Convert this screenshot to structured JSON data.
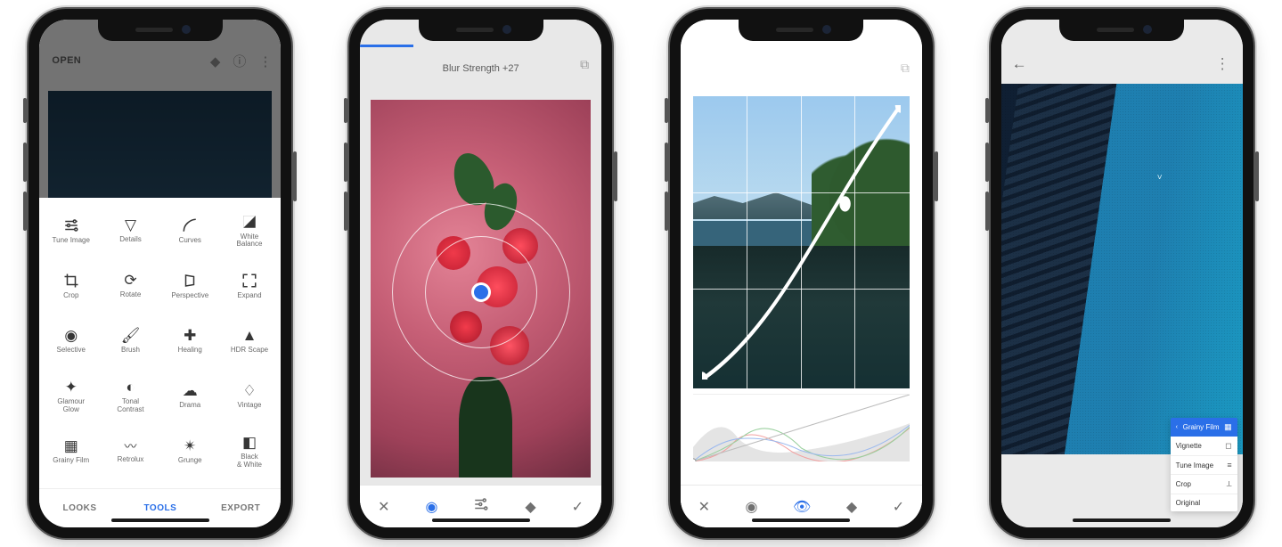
{
  "p1": {
    "header": {
      "open": "OPEN"
    },
    "tools": [
      {
        "label": "Tune Image"
      },
      {
        "label": "Details"
      },
      {
        "label": "Curves"
      },
      {
        "label": "White\nBalance"
      },
      {
        "label": "Crop"
      },
      {
        "label": "Rotate"
      },
      {
        "label": "Perspective"
      },
      {
        "label": "Expand"
      },
      {
        "label": "Selective"
      },
      {
        "label": "Brush"
      },
      {
        "label": "Healing"
      },
      {
        "label": "HDR Scape"
      },
      {
        "label": "Glamour\nGlow"
      },
      {
        "label": "Tonal\nContrast"
      },
      {
        "label": "Drama"
      },
      {
        "label": "Vintage"
      },
      {
        "label": "Grainy Film"
      },
      {
        "label": "Retrolux"
      },
      {
        "label": "Grunge"
      },
      {
        "label": "Black\n& White"
      }
    ],
    "tabs": {
      "looks": "LOOKS",
      "tools": "TOOLS",
      "export": "EXPORT"
    }
  },
  "p2": {
    "param_label": "Blur Strength +27"
  },
  "p4": {
    "stack": {
      "header": "Grainy Film",
      "items": [
        {
          "label": "Vignette"
        },
        {
          "label": "Tune Image"
        },
        {
          "label": "Crop"
        },
        {
          "label": "Original"
        }
      ]
    }
  }
}
